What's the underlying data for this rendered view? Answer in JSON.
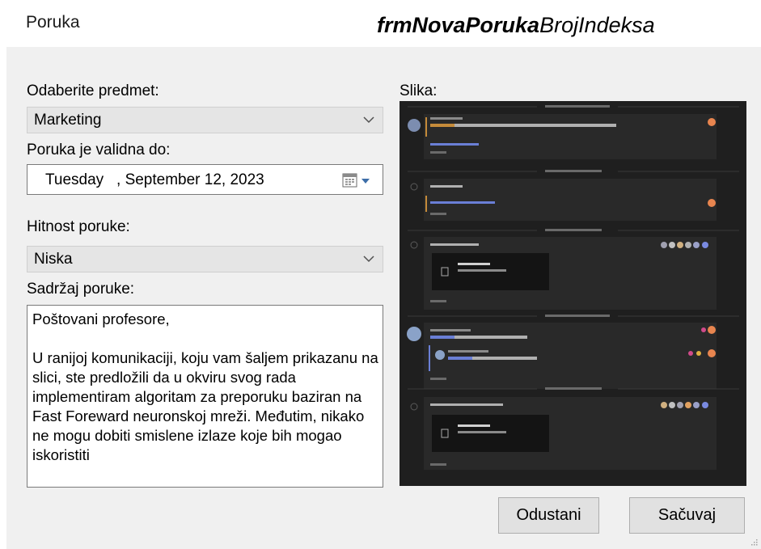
{
  "window": {
    "title": "Poruka",
    "form_name_bold": "frmNovaPoruka",
    "form_name_rest": "BrojIndeksa"
  },
  "subject": {
    "label": "Odaberite predmet:",
    "value": "Marketing"
  },
  "valid_until": {
    "label": "Poruka je validna do:",
    "value": "Tuesday   , September 12, 2023"
  },
  "urgency": {
    "label": "Hitnost poruke:",
    "value": "Niska"
  },
  "content": {
    "label": "Sadržaj poruke:",
    "value": "Poštovani profesore,\n\nU ranijoj komunikaciji, koju vam šaljem prikazanu na slici, ste predložili da u okviru svog rada implementiram algoritam za preporuku baziran na Fast Foreward neuronskoj mreži. Međutim, nikako ne mogu dobiti smislene izlaze koje bih mogao iskoristiti"
  },
  "image": {
    "label": "Slika:"
  },
  "buttons": {
    "cancel": "Odustani",
    "save": "Sačuvaj"
  },
  "icons": {
    "dropdown": "chevron-down-icon",
    "calendar": "calendar-icon"
  },
  "colors": {
    "window_bg": "#ffffff",
    "client_bg": "#f0f0f0",
    "combo_bg": "#e5e5e5",
    "image_bg": "#1f1f1f"
  }
}
